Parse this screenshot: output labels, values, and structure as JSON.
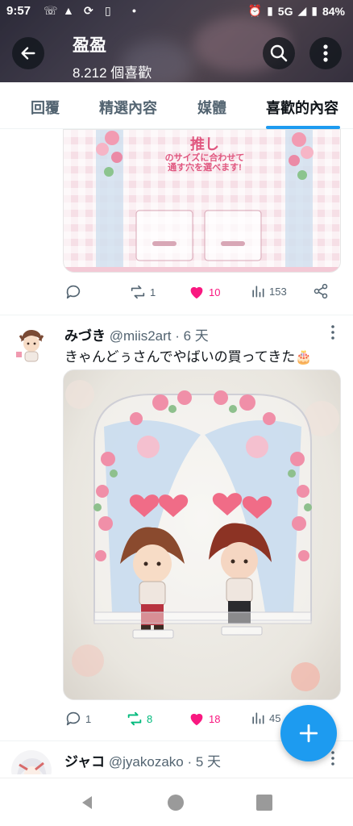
{
  "status_bar": {
    "time": "9:57",
    "network": "5G",
    "battery": "84%"
  },
  "header": {
    "title": "盈盈",
    "subtitle": "8.212 個喜歡",
    "icons": [
      "back-arrow-icon",
      "search-icon",
      "more-vertical-icon"
    ]
  },
  "tabs": [
    {
      "label": "回覆",
      "active": false
    },
    {
      "label": "精選內容",
      "active": false
    },
    {
      "label": "媒體",
      "active": false
    },
    {
      "label": "喜歡的內容",
      "active": true
    }
  ],
  "tweets": [
    {
      "media_text": {
        "line1": "推し",
        "line2": "のサイズに合わせて",
        "line3": "通す穴を選べます!"
      },
      "actions": {
        "replies": "",
        "retweets": "1",
        "likes": "10",
        "views": "153",
        "liked": true
      }
    },
    {
      "display_name": "みづき",
      "handle": "@miis2art",
      "time": "6 天",
      "text": "きゃんどぅさんでやばいの買ってきた🎂",
      "actions": {
        "replies": "1",
        "retweets": "8",
        "likes": "18",
        "views": "45",
        "liked": true,
        "retweeted": true
      }
    },
    {
      "display_name": "ジャコ",
      "handle": "@jyakozako",
      "time": "5 天"
    }
  ],
  "colors": {
    "accent": "#1d9bf0",
    "like": "#f91880",
    "retweet": "#00ba7c",
    "text_secondary": "#536471"
  }
}
